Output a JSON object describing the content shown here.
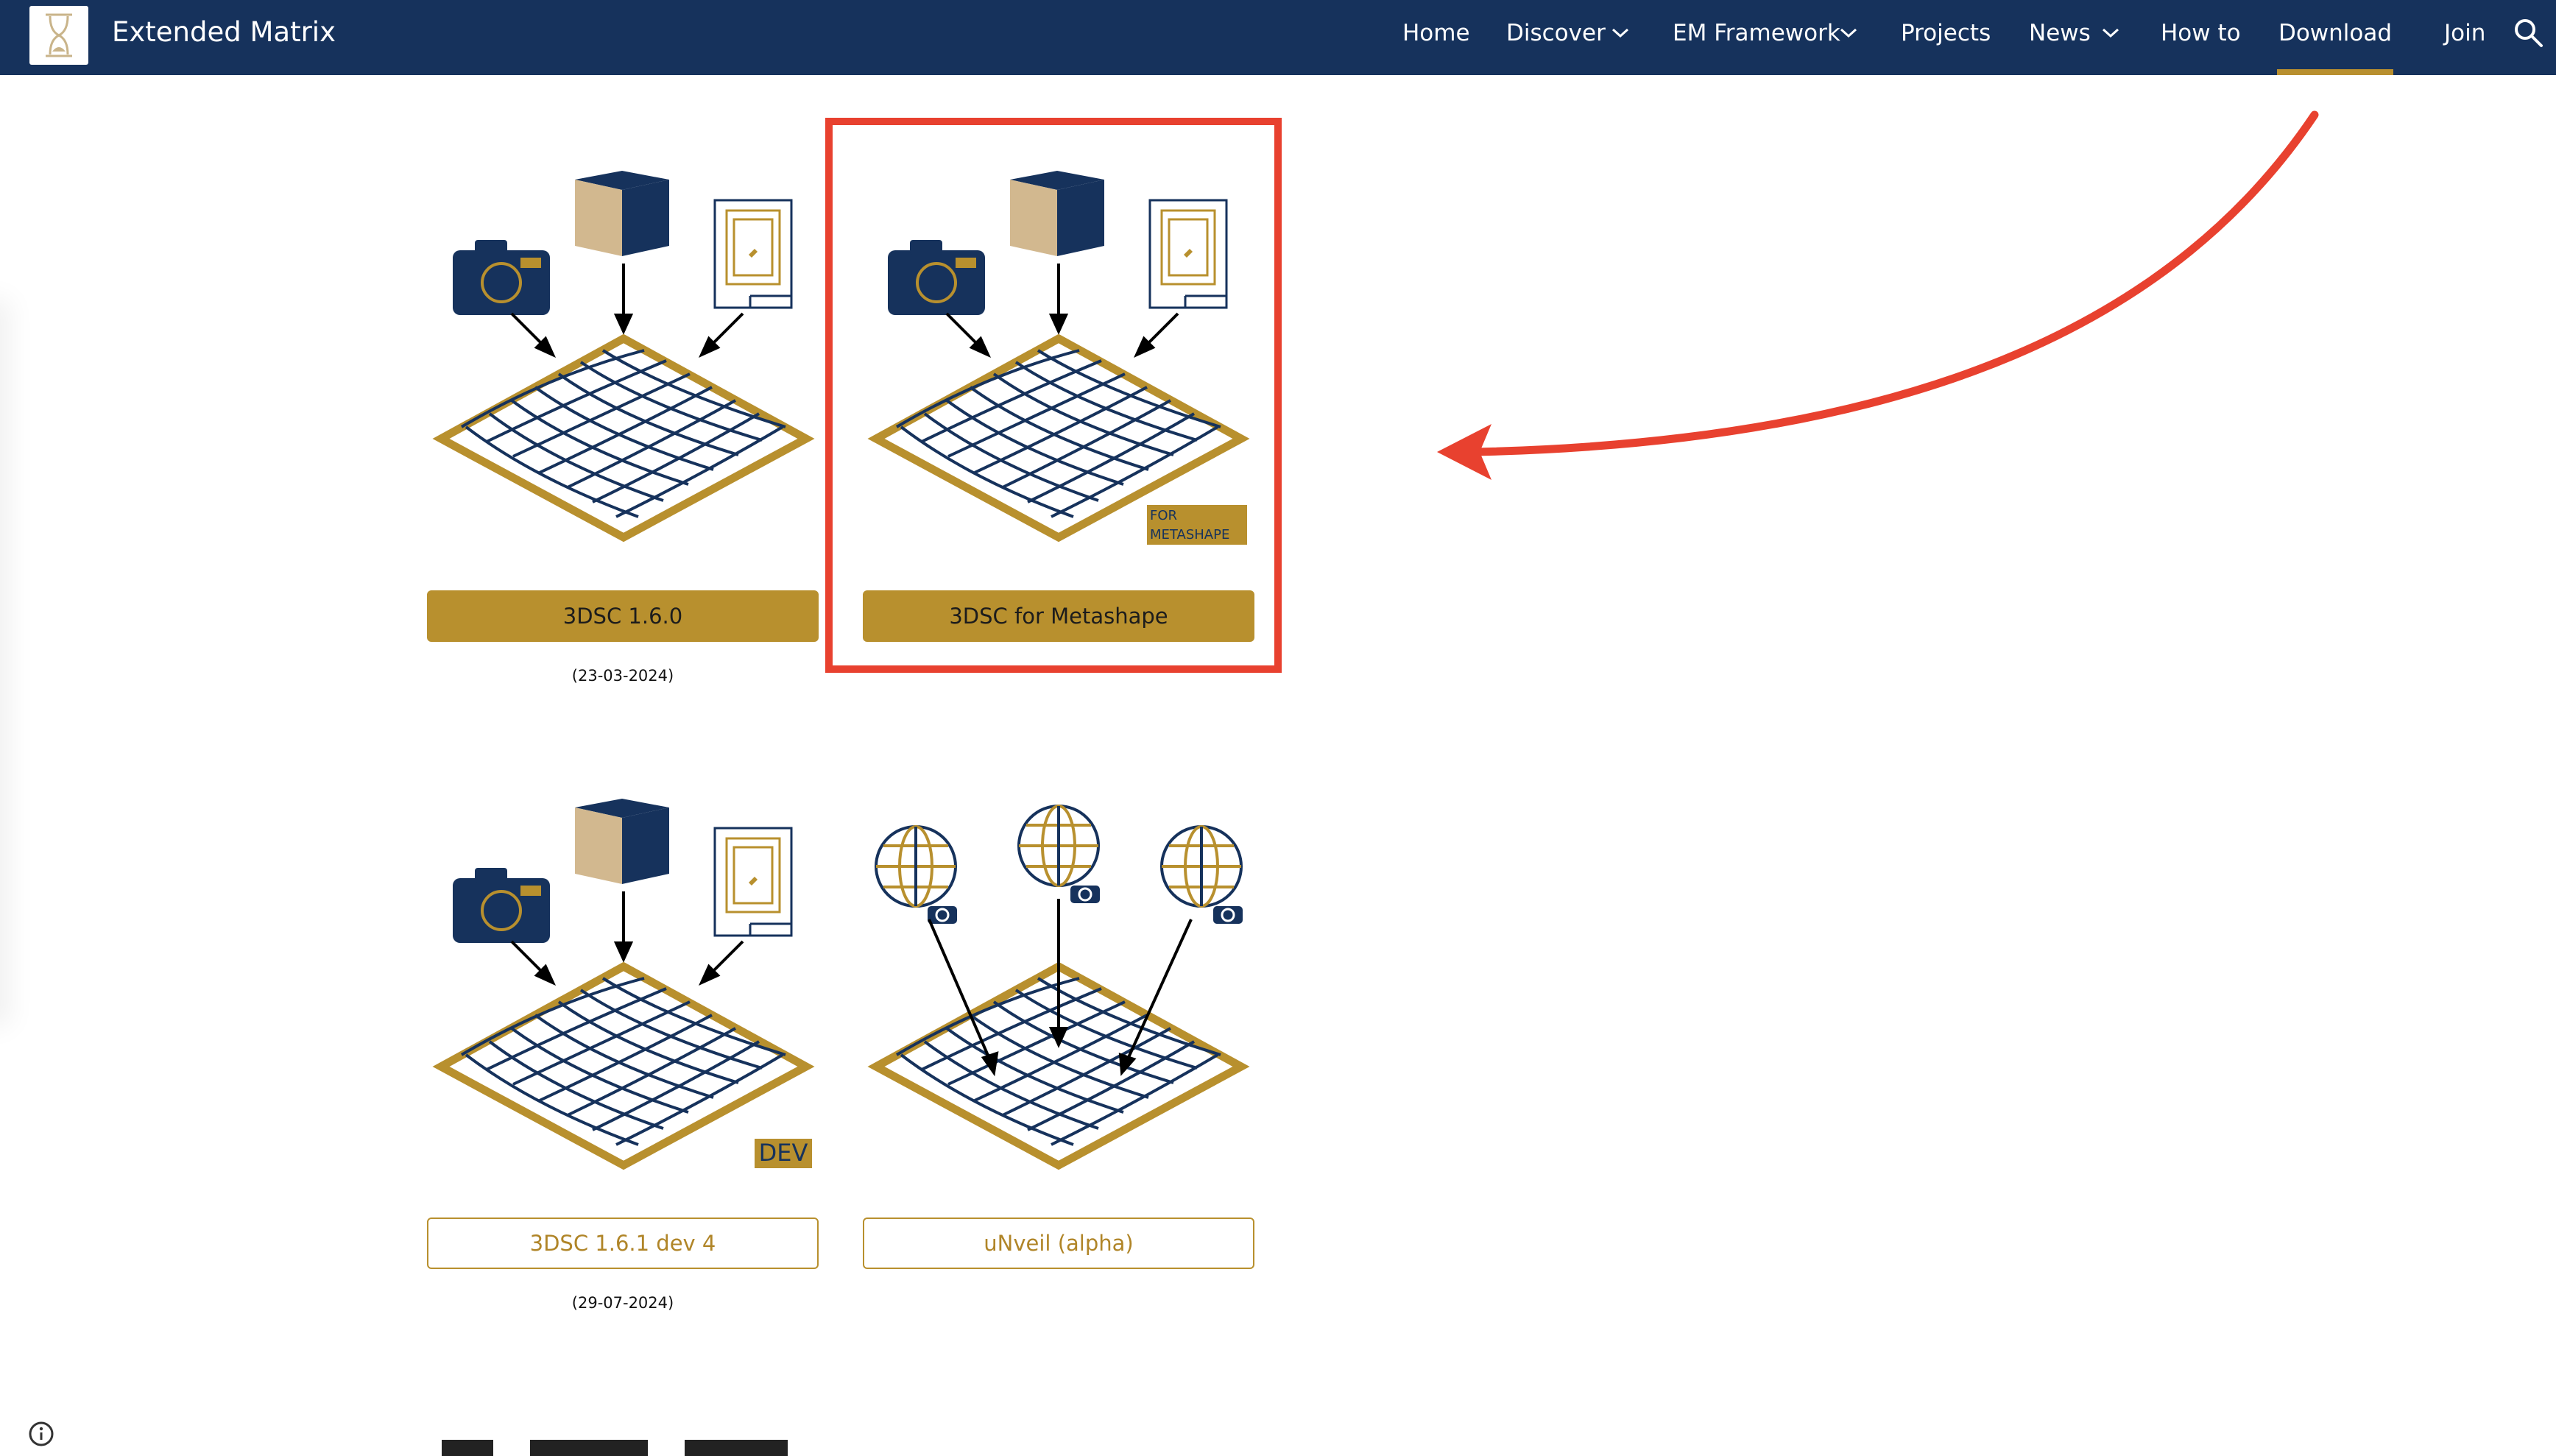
{
  "header": {
    "site_title": "Extended Matrix",
    "nav": [
      {
        "label": "Home"
      },
      {
        "label": "Discover"
      },
      {
        "label": "EM Framework"
      },
      {
        "label": "Projects"
      },
      {
        "label": "News"
      },
      {
        "label": "How to"
      },
      {
        "label": "Download"
      },
      {
        "label": "Join"
      }
    ],
    "active_item": "Download",
    "icons": {
      "logo": "hourglass-logo-icon",
      "search": "search-icon",
      "dropdown": "chevron-down-icon"
    }
  },
  "downloads": [
    {
      "button_label": "3DSC 1.6.0",
      "style": "filled",
      "date": "(23-03-2024)",
      "badge": ""
    },
    {
      "button_label": "3DSC for Metashape",
      "style": "filled",
      "date": "",
      "badge": "FOR METASHAPE",
      "badge_lines": [
        "FOR",
        "METASHAPE"
      ]
    },
    {
      "button_label": "3DSC 1.6.1 dev 4",
      "style": "outline",
      "date": "(29-07-2024)",
      "badge": "DEV"
    },
    {
      "button_label": "uNveil (alpha)",
      "style": "outline",
      "date": "",
      "badge": ""
    }
  ],
  "colors": {
    "header_bg": "#16325c",
    "accent_gold": "#b8902e",
    "navy": "#16325c",
    "cube_light": "#d2b88f",
    "annotation_red": "#e8412f"
  },
  "footer": {
    "info_icon": "info-icon"
  }
}
